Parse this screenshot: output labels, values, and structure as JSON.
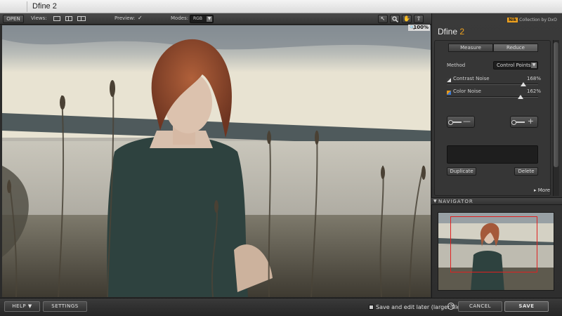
{
  "window": {
    "title": "Dfine 2"
  },
  "toolbar": {
    "open_label": "OPEN",
    "views_label": "Views:",
    "preview_label": "Preview:",
    "preview_checked": true,
    "modes_label": "Modes:",
    "mode_value": "RGB",
    "zoom_level": "100%",
    "tools": [
      "pointer-icon",
      "zoom-icon",
      "hand-icon",
      "upload-icon"
    ]
  },
  "panel": {
    "brand_nik": "Nik",
    "brand_text": "Collection by DxO",
    "app_name": "Dfine",
    "app_version": "2",
    "tabs": [
      {
        "label": "Measure",
        "active": false
      },
      {
        "label": "Reduce",
        "active": true
      }
    ],
    "method_label": "Method",
    "method_value": "Control Points",
    "sliders": [
      {
        "label": "Contrast Noise",
        "value": "168%",
        "fraction": 0.84
      },
      {
        "label": "Color Noise",
        "value": "162%",
        "fraction": 0.81
      }
    ],
    "control_point_buttons": [
      {
        "symbol": "—"
      },
      {
        "symbol": "+"
      }
    ],
    "duplicate_label": "Duplicate",
    "delete_label": "Delete",
    "more_label": "More",
    "navigator_label": "NAVIGATOR"
  },
  "bottom": {
    "help_label": "HELP ▼",
    "settings_label": "SETTINGS",
    "save_later_label": "Save and edit later (larger files)",
    "save_later_checked": false,
    "help_glyph": "?",
    "cancel_label": "CANCEL",
    "save_label": "SAVE"
  }
}
